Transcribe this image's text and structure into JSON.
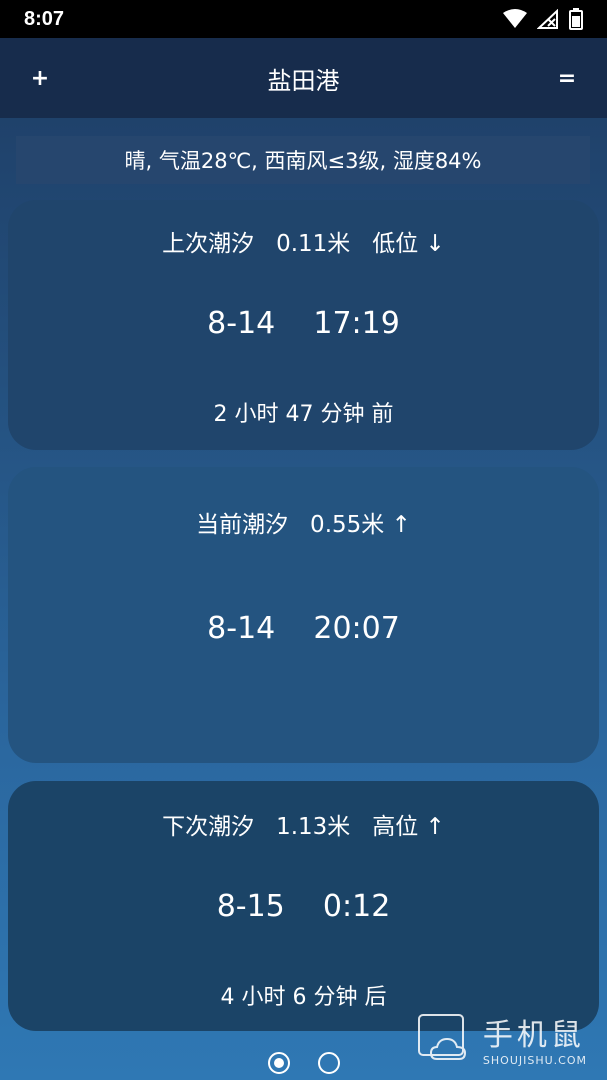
{
  "status": {
    "time": "8:07",
    "icons": [
      "wifi-icon",
      "no-signal-icon",
      "battery-icon"
    ]
  },
  "app_bar": {
    "title": "盐田港",
    "left_button": "+",
    "right_button": "="
  },
  "weather": {
    "summary": "晴, 气温28℃, 西南风≤3级, 湿度84%"
  },
  "cards": {
    "prev": {
      "header": "上次潮汐   0.11米   低位 ↓",
      "datetime": "8-14    17:19",
      "relative": "2 小时 47 分钟 前"
    },
    "now": {
      "header": "当前潮汐   0.55米 ↑",
      "datetime": "8-14    20:07"
    },
    "next": {
      "header": "下次潮汐   1.13米   高位 ↑",
      "datetime": "8-15    0:12",
      "relative": "4 小时 6 分钟 后"
    }
  },
  "pager": {
    "count": 2,
    "active_index": 0
  },
  "watermark": {
    "name": "手机鼠",
    "domain": "SHOUJISHU.COM"
  }
}
